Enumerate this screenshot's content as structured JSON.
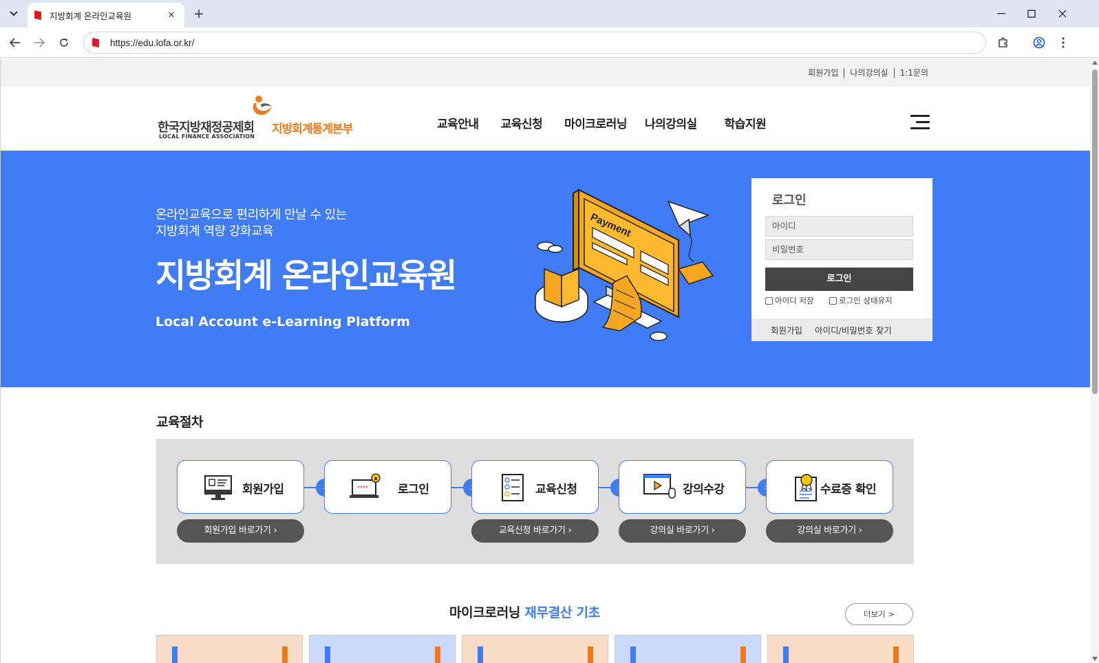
{
  "browser": {
    "tab_title": "지방회계 온라인교육원",
    "url": "https://edu.lofa.or.kr/"
  },
  "util_links": [
    "회원가입",
    "나의강의실",
    "1:1문의"
  ],
  "logo": {
    "org_ko": "한국지방재정공제회",
    "org_en": "LOCAL FINANCE ASSOCIATION",
    "dept": "지방회계통계본부"
  },
  "gnb": [
    "교육안내",
    "교육신청",
    "마이크로러닝",
    "나의강의실",
    "학습지원"
  ],
  "hero": {
    "sub_line1": "온라인교육으로 편리하게 만날 수 있는",
    "sub_line2": "지방회계 역량 강화교육",
    "title": "지방회계 온라인교육원",
    "en": "Local Account e-Learning Platform",
    "art_text": "Payment"
  },
  "login": {
    "title": "로그인",
    "id_placeholder": "아이디",
    "pw_placeholder": "비밀번호",
    "button": "로그인",
    "save_id": "아이디 저장",
    "keep_login": "로그인 상태유지",
    "join": "회원가입",
    "find": "아이디/비밀번호 찾기"
  },
  "process": {
    "title": "교육절차",
    "steps": [
      {
        "label": "회원가입",
        "icon": "monitor-profile-icon",
        "button": "회원가입 바로가기"
      },
      {
        "label": "로그인",
        "icon": "laptop-lock-icon",
        "button": ""
      },
      {
        "label": "교육신청",
        "icon": "checklist-icon",
        "button": "교육신청 바로가기"
      },
      {
        "label": "강의수강",
        "icon": "video-play-icon",
        "button": "강의실 바로가기"
      },
      {
        "label": "수료증 확인",
        "icon": "certificate-icon",
        "button": "강의실 바로가기"
      }
    ]
  },
  "micro": {
    "title_prefix": "마이크로러닝",
    "title_accent": "재무결산 기초",
    "more": "더보기 >"
  },
  "colors": {
    "brand_blue": "#3f7cf6",
    "brand_orange": "#f07a1a",
    "dark_button": "#454545"
  }
}
